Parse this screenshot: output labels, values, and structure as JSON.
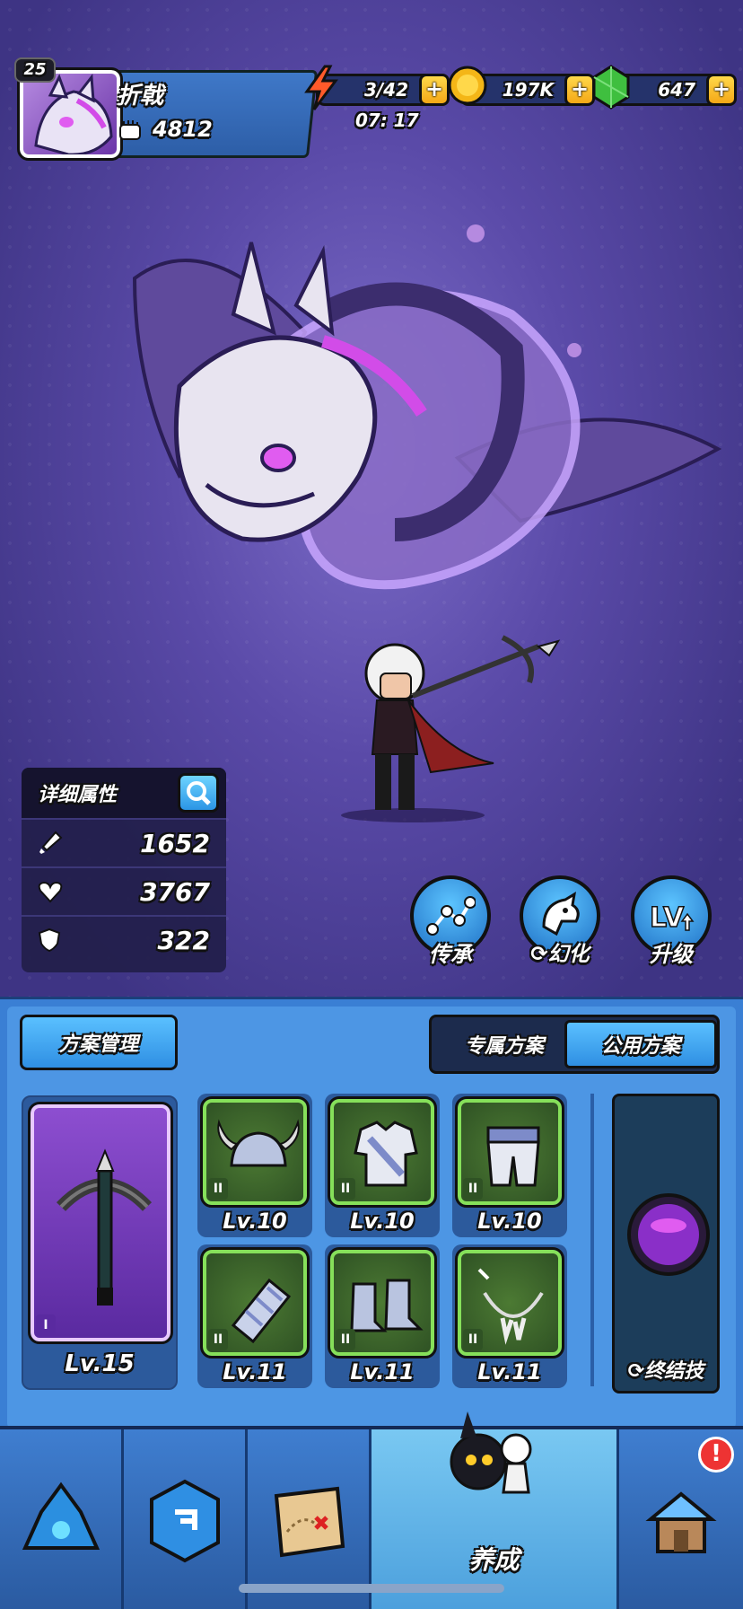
{
  "player": {
    "level": "25",
    "name": "折戟",
    "power": "4812"
  },
  "currency": {
    "energy": "3/42",
    "energy_timer": "07: 17",
    "coins": "197K",
    "gems": "647",
    "plus": "+"
  },
  "stats": {
    "title": "详细属性",
    "attack": "1652",
    "health": "3767",
    "defense": "322"
  },
  "actions": {
    "inherit": "传承",
    "transform": "幻化",
    "upgrade": "升级"
  },
  "panel": {
    "manage": "方案管理",
    "tab_exclusive": "专属方案",
    "tab_public": "公用方案",
    "active_tab": "公用方案"
  },
  "weapon": {
    "tier": "I",
    "level": "Lv.15"
  },
  "equipment": [
    {
      "name": "helmet",
      "tier": "II",
      "level": "Lv.10"
    },
    {
      "name": "armor",
      "tier": "II",
      "level": "Lv.10"
    },
    {
      "name": "pants",
      "tier": "II",
      "level": "Lv.10"
    },
    {
      "name": "bracer",
      "tier": "II",
      "level": "Lv.11"
    },
    {
      "name": "boots",
      "tier": "II",
      "level": "Lv.11"
    },
    {
      "name": "necklace",
      "tier": "II",
      "level": "Lv.11"
    }
  ],
  "ultimate": {
    "label": "终结技"
  },
  "nav": {
    "active": "养成",
    "alert": "!"
  },
  "colors": {
    "accent_blue": "#2f8fe3",
    "coin": "#f4b617",
    "gem": "#3fbf3f",
    "energy": "#ff5a2a",
    "green_slot": "#86e05a",
    "purple_slot": "#8d4ed0"
  }
}
